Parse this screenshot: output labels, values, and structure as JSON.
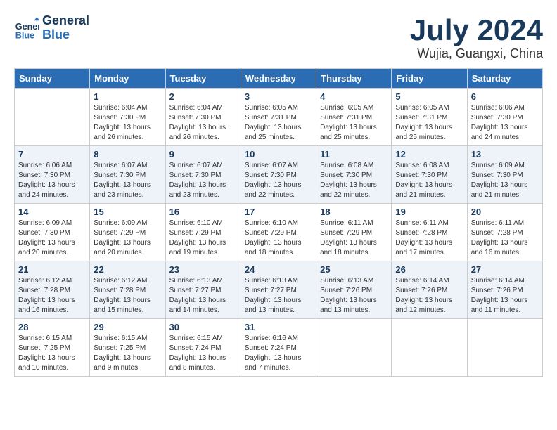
{
  "header": {
    "logo_line1": "General",
    "logo_line2": "Blue",
    "month": "July 2024",
    "location": "Wujia, Guangxi, China"
  },
  "weekdays": [
    "Sunday",
    "Monday",
    "Tuesday",
    "Wednesday",
    "Thursday",
    "Friday",
    "Saturday"
  ],
  "weeks": [
    [
      {
        "day": "",
        "sunrise": "",
        "sunset": "",
        "daylight": ""
      },
      {
        "day": "1",
        "sunrise": "Sunrise: 6:04 AM",
        "sunset": "Sunset: 7:30 PM",
        "daylight": "Daylight: 13 hours and 26 minutes."
      },
      {
        "day": "2",
        "sunrise": "Sunrise: 6:04 AM",
        "sunset": "Sunset: 7:30 PM",
        "daylight": "Daylight: 13 hours and 26 minutes."
      },
      {
        "day": "3",
        "sunrise": "Sunrise: 6:05 AM",
        "sunset": "Sunset: 7:31 PM",
        "daylight": "Daylight: 13 hours and 25 minutes."
      },
      {
        "day": "4",
        "sunrise": "Sunrise: 6:05 AM",
        "sunset": "Sunset: 7:31 PM",
        "daylight": "Daylight: 13 hours and 25 minutes."
      },
      {
        "day": "5",
        "sunrise": "Sunrise: 6:05 AM",
        "sunset": "Sunset: 7:31 PM",
        "daylight": "Daylight: 13 hours and 25 minutes."
      },
      {
        "day": "6",
        "sunrise": "Sunrise: 6:06 AM",
        "sunset": "Sunset: 7:30 PM",
        "daylight": "Daylight: 13 hours and 24 minutes."
      }
    ],
    [
      {
        "day": "7",
        "sunrise": "Sunrise: 6:06 AM",
        "sunset": "Sunset: 7:30 PM",
        "daylight": "Daylight: 13 hours and 24 minutes."
      },
      {
        "day": "8",
        "sunrise": "Sunrise: 6:07 AM",
        "sunset": "Sunset: 7:30 PM",
        "daylight": "Daylight: 13 hours and 23 minutes."
      },
      {
        "day": "9",
        "sunrise": "Sunrise: 6:07 AM",
        "sunset": "Sunset: 7:30 PM",
        "daylight": "Daylight: 13 hours and 23 minutes."
      },
      {
        "day": "10",
        "sunrise": "Sunrise: 6:07 AM",
        "sunset": "Sunset: 7:30 PM",
        "daylight": "Daylight: 13 hours and 22 minutes."
      },
      {
        "day": "11",
        "sunrise": "Sunrise: 6:08 AM",
        "sunset": "Sunset: 7:30 PM",
        "daylight": "Daylight: 13 hours and 22 minutes."
      },
      {
        "day": "12",
        "sunrise": "Sunrise: 6:08 AM",
        "sunset": "Sunset: 7:30 PM",
        "daylight": "Daylight: 13 hours and 21 minutes."
      },
      {
        "day": "13",
        "sunrise": "Sunrise: 6:09 AM",
        "sunset": "Sunset: 7:30 PM",
        "daylight": "Daylight: 13 hours and 21 minutes."
      }
    ],
    [
      {
        "day": "14",
        "sunrise": "Sunrise: 6:09 AM",
        "sunset": "Sunset: 7:30 PM",
        "daylight": "Daylight: 13 hours and 20 minutes."
      },
      {
        "day": "15",
        "sunrise": "Sunrise: 6:09 AM",
        "sunset": "Sunset: 7:29 PM",
        "daylight": "Daylight: 13 hours and 20 minutes."
      },
      {
        "day": "16",
        "sunrise": "Sunrise: 6:10 AM",
        "sunset": "Sunset: 7:29 PM",
        "daylight": "Daylight: 13 hours and 19 minutes."
      },
      {
        "day": "17",
        "sunrise": "Sunrise: 6:10 AM",
        "sunset": "Sunset: 7:29 PM",
        "daylight": "Daylight: 13 hours and 18 minutes."
      },
      {
        "day": "18",
        "sunrise": "Sunrise: 6:11 AM",
        "sunset": "Sunset: 7:29 PM",
        "daylight": "Daylight: 13 hours and 18 minutes."
      },
      {
        "day": "19",
        "sunrise": "Sunrise: 6:11 AM",
        "sunset": "Sunset: 7:28 PM",
        "daylight": "Daylight: 13 hours and 17 minutes."
      },
      {
        "day": "20",
        "sunrise": "Sunrise: 6:11 AM",
        "sunset": "Sunset: 7:28 PM",
        "daylight": "Daylight: 13 hours and 16 minutes."
      }
    ],
    [
      {
        "day": "21",
        "sunrise": "Sunrise: 6:12 AM",
        "sunset": "Sunset: 7:28 PM",
        "daylight": "Daylight: 13 hours and 16 minutes."
      },
      {
        "day": "22",
        "sunrise": "Sunrise: 6:12 AM",
        "sunset": "Sunset: 7:28 PM",
        "daylight": "Daylight: 13 hours and 15 minutes."
      },
      {
        "day": "23",
        "sunrise": "Sunrise: 6:13 AM",
        "sunset": "Sunset: 7:27 PM",
        "daylight": "Daylight: 13 hours and 14 minutes."
      },
      {
        "day": "24",
        "sunrise": "Sunrise: 6:13 AM",
        "sunset": "Sunset: 7:27 PM",
        "daylight": "Daylight: 13 hours and 13 minutes."
      },
      {
        "day": "25",
        "sunrise": "Sunrise: 6:13 AM",
        "sunset": "Sunset: 7:26 PM",
        "daylight": "Daylight: 13 hours and 13 minutes."
      },
      {
        "day": "26",
        "sunrise": "Sunrise: 6:14 AM",
        "sunset": "Sunset: 7:26 PM",
        "daylight": "Daylight: 13 hours and 12 minutes."
      },
      {
        "day": "27",
        "sunrise": "Sunrise: 6:14 AM",
        "sunset": "Sunset: 7:26 PM",
        "daylight": "Daylight: 13 hours and 11 minutes."
      }
    ],
    [
      {
        "day": "28",
        "sunrise": "Sunrise: 6:15 AM",
        "sunset": "Sunset: 7:25 PM",
        "daylight": "Daylight: 13 hours and 10 minutes."
      },
      {
        "day": "29",
        "sunrise": "Sunrise: 6:15 AM",
        "sunset": "Sunset: 7:25 PM",
        "daylight": "Daylight: 13 hours and 9 minutes."
      },
      {
        "day": "30",
        "sunrise": "Sunrise: 6:15 AM",
        "sunset": "Sunset: 7:24 PM",
        "daylight": "Daylight: 13 hours and 8 minutes."
      },
      {
        "day": "31",
        "sunrise": "Sunrise: 6:16 AM",
        "sunset": "Sunset: 7:24 PM",
        "daylight": "Daylight: 13 hours and 7 minutes."
      },
      {
        "day": "",
        "sunrise": "",
        "sunset": "",
        "daylight": ""
      },
      {
        "day": "",
        "sunrise": "",
        "sunset": "",
        "daylight": ""
      },
      {
        "day": "",
        "sunrise": "",
        "sunset": "",
        "daylight": ""
      }
    ]
  ]
}
